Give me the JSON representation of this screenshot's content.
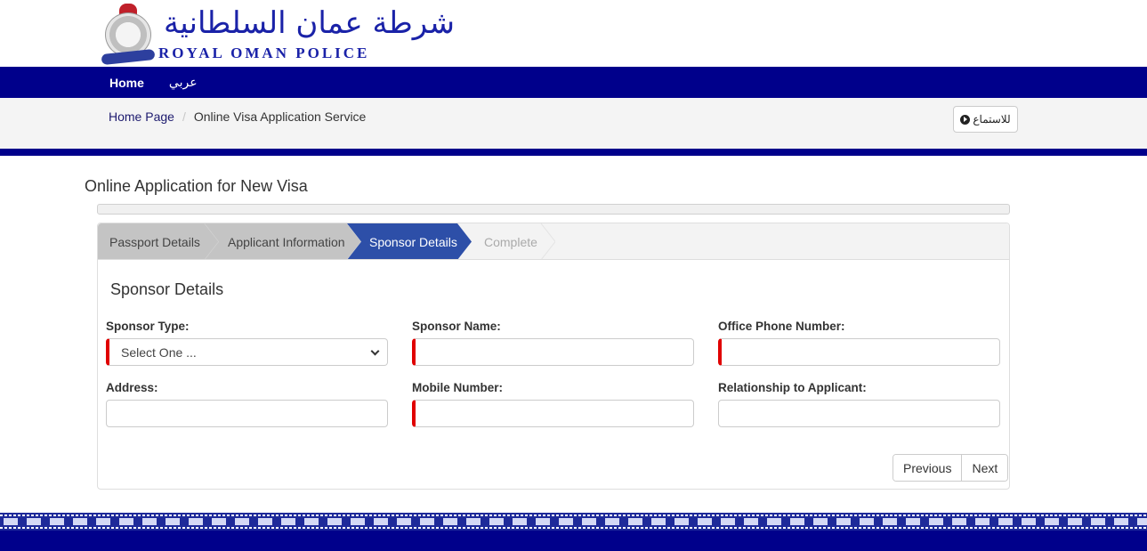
{
  "brand": {
    "arabic_name": "شرطة عمان السلطانية",
    "english_name": "ROYAL OMAN POLICE"
  },
  "nav": {
    "items": [
      {
        "label": "Home"
      },
      {
        "label": "عربي"
      }
    ]
  },
  "breadcrumb": {
    "home": "Home Page",
    "separator": "/",
    "current": "Online Visa Application Service"
  },
  "listen_button": {
    "label": "للاستماع",
    "icon": "play-circle-icon"
  },
  "page": {
    "title": "Online Application for New Visa",
    "progress_percent": 0
  },
  "steps": [
    {
      "label": "Passport Details",
      "state": "done"
    },
    {
      "label": "Applicant Information",
      "state": "done"
    },
    {
      "label": "Sponsor Details",
      "state": "active"
    },
    {
      "label": "Complete",
      "state": "pending"
    }
  ],
  "form": {
    "section_title": "Sponsor Details",
    "fields": {
      "sponsor_type": {
        "label": "Sponsor Type:",
        "value": "Select One ...",
        "required": true
      },
      "sponsor_name": {
        "label": "Sponsor Name:",
        "value": "",
        "required": true
      },
      "office_phone": {
        "label": "Office Phone Number:",
        "value": "",
        "required": true
      },
      "address": {
        "label": "Address:",
        "value": "",
        "required": false
      },
      "mobile": {
        "label": "Mobile Number:",
        "value": "",
        "required": true
      },
      "relationship": {
        "label": "Relationship to Applicant:",
        "value": "",
        "required": false
      }
    },
    "buttons": {
      "previous": "Previous",
      "next": "Next"
    }
  },
  "colors": {
    "nav_blue": "#00008b",
    "active_step": "#2d4fa8",
    "done_step": "#c4c4c4",
    "required_marker": "#e00000"
  }
}
